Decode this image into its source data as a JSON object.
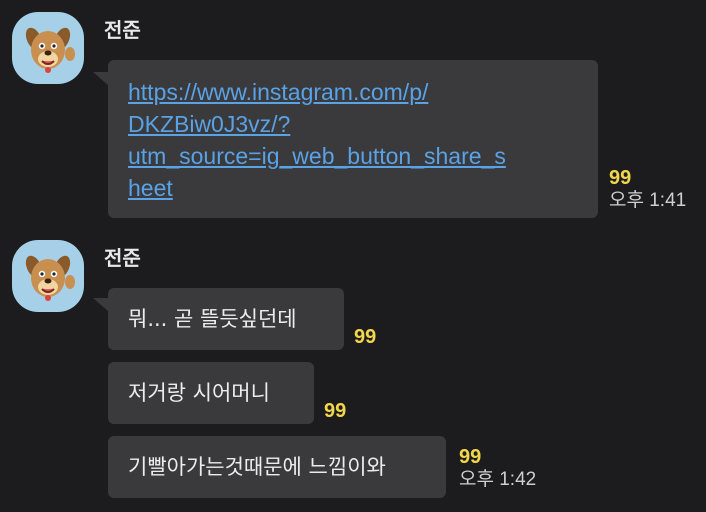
{
  "messages": [
    {
      "sender": "전준",
      "avatar": "dog-character-avatar",
      "link": "https://www.instagram.com/p/\nDKZBiw0J3vz/?\nutm_source=ig_web_button_share_s\nheet",
      "unread": "99",
      "time": "오후 1:41"
    },
    {
      "sender": "전준",
      "avatar": "dog-character-avatar",
      "texts": [
        "뭐... 곧 뜰듯싶던데",
        "저거랑 시어머니",
        "기빨아가는것때문에 느낌이와"
      ],
      "unread": [
        "99",
        "99",
        "99"
      ],
      "time": "오후 1:42"
    }
  ],
  "colors": {
    "background": "#1c1c1e",
    "bubble": "#3a3a3c",
    "link": "#5aa2e6",
    "unread": "#f2d64b",
    "avatar_bg": "#a6d0e8"
  }
}
